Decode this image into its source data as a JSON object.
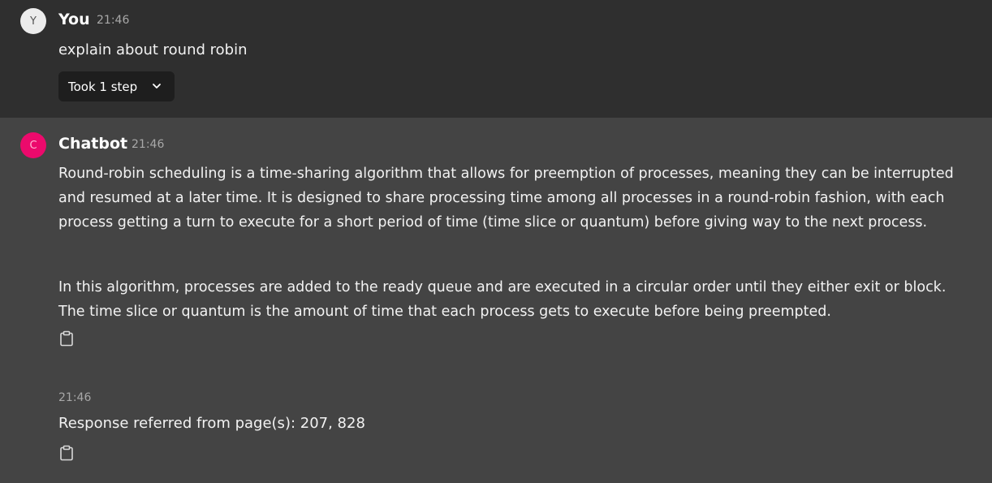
{
  "user_message": {
    "avatar_letter": "Y",
    "author": "You",
    "time": "21:46",
    "text": "explain about round robin",
    "steps_label": "Took 1 step"
  },
  "bot_message": {
    "avatar_letter": "C",
    "author": "Chatbot",
    "time": "21:46",
    "paragraphs": [
      "Round-robin scheduling is a time-sharing algorithm that allows for preemption of processes, meaning they can be interrupted and resumed at a later time. It is designed to share processing time among all processes in a round-robin fashion, with each process getting a turn to execute for a short period of time (time slice or quantum) before giving way to the next process.",
      "In this algorithm, processes are added to the ready queue and are executed in a circular order until they either exit or block. The time slice or quantum is the amount of time that each process gets to execute before being preempted."
    ],
    "reference_time": "21:46",
    "reference_text": "Response referred from page(s): 207, 828"
  },
  "icons": {
    "copy": "clipboard-icon",
    "expand": "chevron-down-icon"
  },
  "colors": {
    "user_background": "#2f2f2f",
    "bot_background": "#444444",
    "bot_avatar": "#ec0a6c",
    "button_background": "#1e1e1e"
  }
}
